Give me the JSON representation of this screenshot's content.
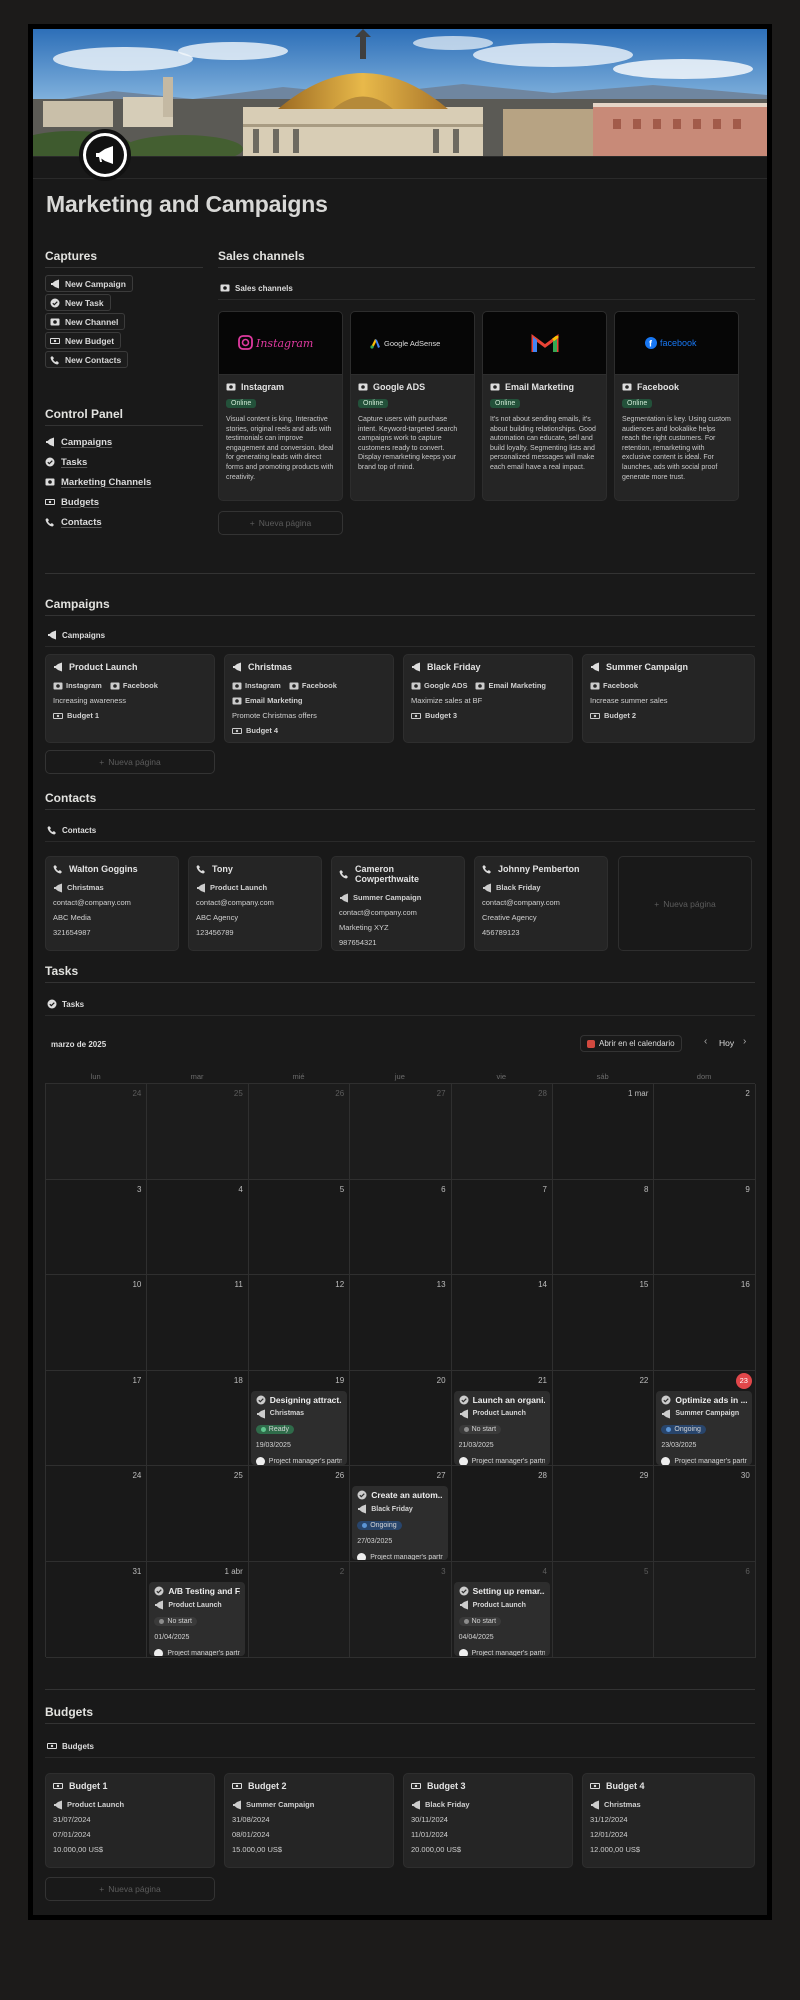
{
  "page": {
    "title": "Marketing and Campaigns"
  },
  "colors": {
    "background": "#191919",
    "online_tag": "#23513a",
    "ready": "#2f6b4a",
    "ongoing": "#28456c",
    "today": "#e0474a"
  },
  "captures": {
    "heading": "Captures",
    "buttons": [
      {
        "label": "New Campaign",
        "icon": "megaphone-icon"
      },
      {
        "label": "New Task",
        "icon": "check-circle-icon"
      },
      {
        "label": "New Channel",
        "icon": "channel-icon"
      },
      {
        "label": "New Budget",
        "icon": "budget-icon"
      },
      {
        "label": "New Contacts",
        "icon": "phone-icon"
      }
    ]
  },
  "control_panel": {
    "heading": "Control Panel",
    "items": [
      {
        "label": "Campaigns",
        "icon": "megaphone-icon"
      },
      {
        "label": "Tasks",
        "icon": "check-circle-icon"
      },
      {
        "label": "Marketing Channels",
        "icon": "channel-icon"
      },
      {
        "label": "Budgets",
        "icon": "budget-icon"
      },
      {
        "label": "Contacts",
        "icon": "phone-icon"
      }
    ]
  },
  "sales_channels": {
    "heading": "Sales channels",
    "view_label": "Sales channels",
    "new_page": "Nueva página",
    "cards": [
      {
        "name": "Instagram",
        "logo": "Instagram",
        "status": "Online",
        "desc": "Visual content is king. Interactive stories, original reels and ads with testimonials can improve engagement and conversion. Ideal for generating leads with direct forms and promoting products with creativity."
      },
      {
        "name": "Google ADS",
        "logo": "Google AdSense",
        "status": "Online",
        "desc": "Capture users with purchase intent. Keyword-targeted search campaigns work to capture customers ready to convert. Display remarketing keeps your brand top of mind."
      },
      {
        "name": "Email Marketing",
        "logo": "M",
        "status": "Online",
        "desc": "It's not about sending emails, it's about building relationships. Good automation can educate, sell and build loyalty. Segmenting lists and personalized messages will make each email have a real impact."
      },
      {
        "name": "Facebook",
        "logo": "facebook",
        "status": "Online",
        "desc": "Segmentation is key. Using custom audiences and lookalike helps reach the right customers. For retention, remarketing with exclusive content is ideal. For launches, ads with social proof generate more trust."
      }
    ]
  },
  "campaigns": {
    "heading": "Campaigns",
    "view_label": "Campaigns",
    "new_page": "Nueva página",
    "cards": [
      {
        "name": "Product Launch",
        "channels": [
          "Instagram",
          "Facebook"
        ],
        "goal": "Increasing awareness",
        "budget": "Budget 1"
      },
      {
        "name": "Christmas",
        "channels": [
          "Instagram",
          "Facebook",
          "Email Marketing"
        ],
        "goal": "Promote Christmas offers",
        "budget": "Budget 4"
      },
      {
        "name": "Black Friday",
        "channels": [
          "Google ADS",
          "Email Marketing"
        ],
        "goal": "Maximize sales at BF",
        "budget": "Budget 3"
      },
      {
        "name": "Summer Campaign",
        "channels": [
          "Facebook"
        ],
        "goal": "Increase summer sales",
        "budget": "Budget 2"
      }
    ]
  },
  "contacts": {
    "heading": "Contacts",
    "view_label": "Contacts",
    "new_page": "Nueva página",
    "cards": [
      {
        "name": "Walton Goggins",
        "campaign": "Christmas",
        "email": "contact@company.com",
        "company": "ABC Media",
        "phone": "321654987"
      },
      {
        "name": "Tony",
        "campaign": "Product Launch",
        "email": "contact@company.com",
        "company": "ABC Agency",
        "phone": "123456789"
      },
      {
        "name": "Cameron Cowperthwaite",
        "campaign": "Summer Campaign",
        "email": "contact@company.com",
        "company": "Marketing XYZ",
        "phone": "987654321"
      },
      {
        "name": "Johnny Pemberton",
        "campaign": "Black Friday",
        "email": "contact@company.com",
        "company": "Creative Agency",
        "phone": "456789123"
      }
    ]
  },
  "tasks": {
    "heading": "Tasks",
    "view_label": "Tasks",
    "month": "marzo de 2025",
    "open_calendar": "Abrir en el calendario",
    "today_btn": "Hoy",
    "weekdays": [
      "lun",
      "mar",
      "mié",
      "jue",
      "vie",
      "sáb",
      "dom"
    ],
    "days": [
      "24",
      "25",
      "26",
      "27",
      "28",
      "1 mar",
      "2",
      "3",
      "4",
      "5",
      "6",
      "7",
      "8",
      "9",
      "10",
      "11",
      "12",
      "13",
      "14",
      "15",
      "16",
      "17",
      "18",
      "19",
      "20",
      "21",
      "22",
      "23",
      "24",
      "25",
      "26",
      "27",
      "28",
      "29",
      "30",
      "31",
      "1 abr",
      "2",
      "3",
      "4",
      "5",
      "6"
    ],
    "today_index": 27,
    "events": [
      {
        "day_index": 23,
        "title": "Designing attract...",
        "campaign": "Christmas",
        "status": "Ready",
        "date": "19/03/2025",
        "person": "Project manager's partner"
      },
      {
        "day_index": 25,
        "title": "Launch an organi...",
        "campaign": "Product Launch",
        "status": "No start",
        "date": "21/03/2025",
        "person": "Project manager's partner"
      },
      {
        "day_index": 27,
        "title": "Optimize ads in ...",
        "campaign": "Summer Campaign",
        "status": "Ongoing",
        "date": "23/03/2025",
        "person": "Project manager's partner"
      },
      {
        "day_index": 31,
        "title": "Create an autom...",
        "campaign": "Black Friday",
        "status": "Ongoing",
        "date": "27/03/2025",
        "person": "Project manager's partner"
      },
      {
        "day_index": 36,
        "title": "A/B Testing and F...",
        "campaign": "Product Launch",
        "status": "No start",
        "date": "01/04/2025",
        "person": "Project manager's partner"
      },
      {
        "day_index": 39,
        "title": "Setting up remar...",
        "campaign": "Product Launch",
        "status": "No start",
        "date": "04/04/2025",
        "person": "Project manager's partner"
      }
    ]
  },
  "budgets": {
    "heading": "Budgets",
    "view_label": "Budgets",
    "new_page": "Nueva página",
    "cards": [
      {
        "name": "Budget 1",
        "campaign": "Product Launch",
        "end": "31/07/2024",
        "start": "07/01/2024",
        "amount": "10.000,00 US$"
      },
      {
        "name": "Budget 2",
        "campaign": "Summer Campaign",
        "end": "31/08/2024",
        "start": "08/01/2024",
        "amount": "15.000,00 US$"
      },
      {
        "name": "Budget 3",
        "campaign": "Black Friday",
        "end": "30/11/2024",
        "start": "11/01/2024",
        "amount": "20.000,00 US$"
      },
      {
        "name": "Budget 4",
        "campaign": "Christmas",
        "end": "31/12/2024",
        "start": "12/01/2024",
        "amount": "12.000,00 US$"
      }
    ]
  }
}
